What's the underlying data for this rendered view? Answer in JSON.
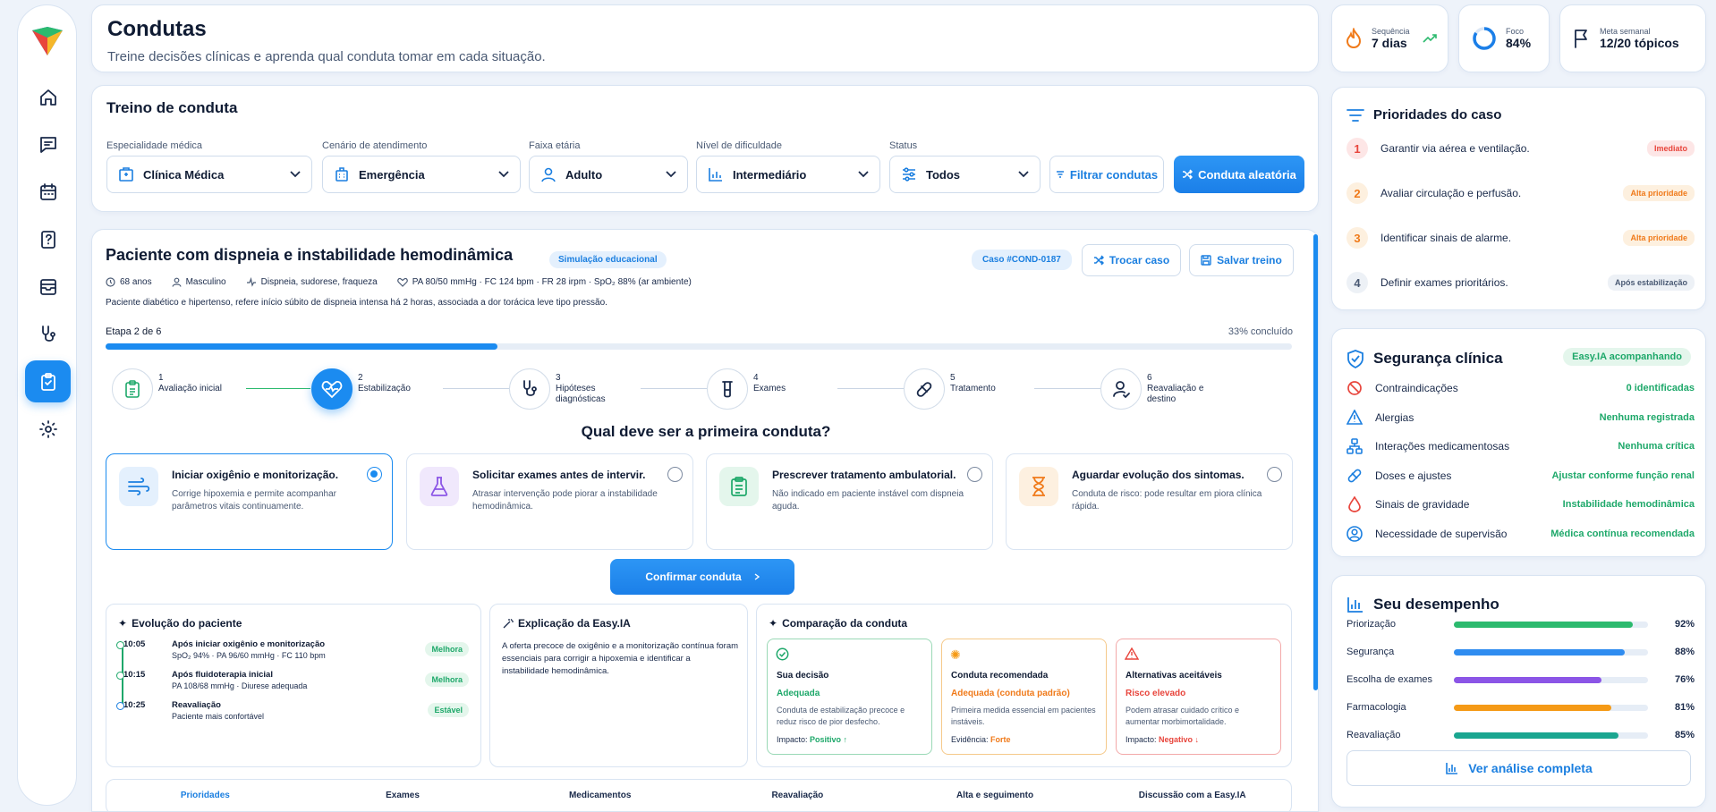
{
  "header": {
    "title": "Condutas",
    "subtitle": "Treine decisões clínicas e aprenda qual conduta tomar em cada situação."
  },
  "stats": [
    {
      "label": "Sequência",
      "value": "7 dias",
      "icon": "flame-icon"
    },
    {
      "label": "Foco",
      "value": "84%",
      "icon": "focus-ring-icon",
      "percent": 84
    },
    {
      "label": "Meta semanal",
      "value": "12/20 tópicos",
      "icon": "flag-icon"
    }
  ],
  "training": {
    "title": "Treino de conduta",
    "filters": [
      {
        "label": "Especialidade médica",
        "value": "Clínica Médica",
        "icon": "hospital-icon"
      },
      {
        "label": "Cenário de atendimento",
        "value": "Emergência",
        "icon": "building-icon"
      },
      {
        "label": "Faixa etária",
        "value": "Adulto",
        "icon": "person-icon"
      },
      {
        "label": "Nível de dificuldade",
        "value": "Intermediário",
        "icon": "bar-chart-icon"
      },
      {
        "label": "Status",
        "value": "Todos",
        "icon": "sliders-icon"
      }
    ],
    "filter_button": "Filtrar condutas",
    "random_button": "Conduta aleatória"
  },
  "case": {
    "title": "Paciente com dispneia e instabilidade hemodinâmica",
    "tag": "Simulação educacional",
    "code": "Caso #COND-0187",
    "swap_button": "Trocar caso",
    "save_button": "Salvar treino",
    "meta": {
      "age": "68 anos",
      "sex": "Masculino",
      "symptoms": "Dispneia, sudorese, fraqueza",
      "vitals": "PA 80/50 mmHg · FC 124 bpm · FR 28 irpm · SpO₂ 88% (ar ambiente)"
    },
    "history": "Paciente diabético e hipertenso, refere início súbito de dispneia intensa há 2 horas, associada a dor torácica leve tipo pressão.",
    "stage": "Etapa 2 de 6",
    "progress_label": "33% concluído",
    "progress": 33,
    "steps": [
      {
        "num": "1",
        "label": "Avaliação inicial"
      },
      {
        "num": "2",
        "label": "Estabilização"
      },
      {
        "num": "3",
        "label": "Hipóteses diagnósticas"
      },
      {
        "num": "4",
        "label": "Exames"
      },
      {
        "num": "5",
        "label": "Tratamento"
      },
      {
        "num": "6",
        "label": "Reavaliação e destino"
      }
    ],
    "question": "Qual deve ser a primeira conduta?",
    "options": [
      {
        "title": "Iniciar oxigênio e monitorização.",
        "desc": "Corrige hipoxemia e permite acompanhar parâmetros vitais continuamente."
      },
      {
        "title": "Solicitar exames antes de intervir.",
        "desc": "Atrasar intervenção pode piorar a instabilidade hemodinâmica."
      },
      {
        "title": "Prescrever tratamento ambulatorial.",
        "desc": "Não indicado em paciente instável com dispneia aguda."
      },
      {
        "title": "Aguardar evolução dos sintomas.",
        "desc": "Conduta de risco: pode resultar em piora clínica rápida."
      }
    ],
    "confirm_button": "Confirmar conduta",
    "evolution": {
      "title": "Evolução do paciente",
      "rows": [
        {
          "time": "10:05",
          "title": "Após iniciar oxigênio e monitorização",
          "detail": "SpO₂ 94% · PA 96/60 mmHg · FC 110 bpm",
          "status": "Melhora"
        },
        {
          "time": "10:15",
          "title": "Após fluidoterapia inicial",
          "detail": "PA 108/68 mmHg · Diurese adequada",
          "status": "Melhora"
        },
        {
          "time": "10:25",
          "title": "Reavaliação",
          "detail": "Paciente mais confortável",
          "status": "Estável"
        }
      ]
    },
    "explanation": {
      "title": "Explicação da Easy.IA",
      "text": "A oferta precoce de oxigênio e a monitorização contínua foram essenciais para corrigir a hipoxemia e identificar a instabilidade hemodinâmica."
    },
    "comparison": {
      "title": "Comparação da conduta",
      "items": [
        {
          "title": "Sua decisão",
          "status": "Adequada",
          "desc": "Conduta de estabilização precoce e reduz risco de pior desfecho.",
          "impact_label": "Impacto:",
          "impact": "Positivo ↑"
        },
        {
          "title": "Conduta recomendada",
          "status": "Adequada (conduta padrão)",
          "desc": "Primeira medida essencial em pacientes instáveis.",
          "impact_label": "Evidência:",
          "impact": "Forte"
        },
        {
          "title": "Alternativas aceitáveis",
          "status": "Risco elevado",
          "desc": "Podem atrasar cuidado crítico e aumentar morbimortalidade.",
          "impact_label": "Impacto:",
          "impact": "Negativo ↓"
        }
      ]
    },
    "tabs": [
      "Prioridades",
      "Exames",
      "Medicamentos",
      "Reavaliação",
      "Alta e seguimento",
      "Discussão com a Easy.IA"
    ]
  },
  "priorities": {
    "title": "Prioridades do caso",
    "items": [
      {
        "num": "1",
        "text": "Garantir via aérea e ventilação.",
        "badge": "Imediato"
      },
      {
        "num": "2",
        "text": "Avaliar circulação e perfusão.",
        "badge": "Alta prioridade"
      },
      {
        "num": "3",
        "text": "Identificar sinais de alarme.",
        "badge": "Alta prioridade"
      },
      {
        "num": "4",
        "text": "Definir exames prioritários.",
        "badge": "Após estabilização"
      }
    ]
  },
  "safety": {
    "title": "Segurança clínica",
    "badge": "Easy.IA acompanhando",
    "items": [
      {
        "label": "Contraindicações",
        "value": "0 identificadas",
        "icon": "ban-icon"
      },
      {
        "label": "Alergias",
        "value": "Nenhuma registrada",
        "icon": "warning-icon"
      },
      {
        "label": "Interações medicamentosas",
        "value": "Nenhuma crítica",
        "icon": "network-icon"
      },
      {
        "label": "Doses e ajustes",
        "value": "Ajustar conforme função renal",
        "icon": "pill-icon"
      },
      {
        "label": "Sinais de gravidade",
        "value": "Instabilidade hemodinâmica",
        "icon": "drop-icon"
      },
      {
        "label": "Necessidade de supervisão",
        "value": "Médica contínua recomendada",
        "icon": "user-circle-icon"
      }
    ]
  },
  "performance": {
    "title": "Seu desempenho",
    "items": [
      {
        "label": "Priorização",
        "value": "92%",
        "pct": 92,
        "color": "#2cba6e"
      },
      {
        "label": "Segurança",
        "value": "88%",
        "pct": 88,
        "color": "#2f8cf0"
      },
      {
        "label": "Escolha de exames",
        "value": "76%",
        "pct": 76,
        "color": "#8b55e6"
      },
      {
        "label": "Farmacologia",
        "value": "81%",
        "pct": 81,
        "color": "#f59a16"
      },
      {
        "label": "Reavaliação",
        "value": "85%",
        "pct": 85,
        "color": "#1aa690"
      }
    ],
    "button": "Ver análise completa"
  }
}
